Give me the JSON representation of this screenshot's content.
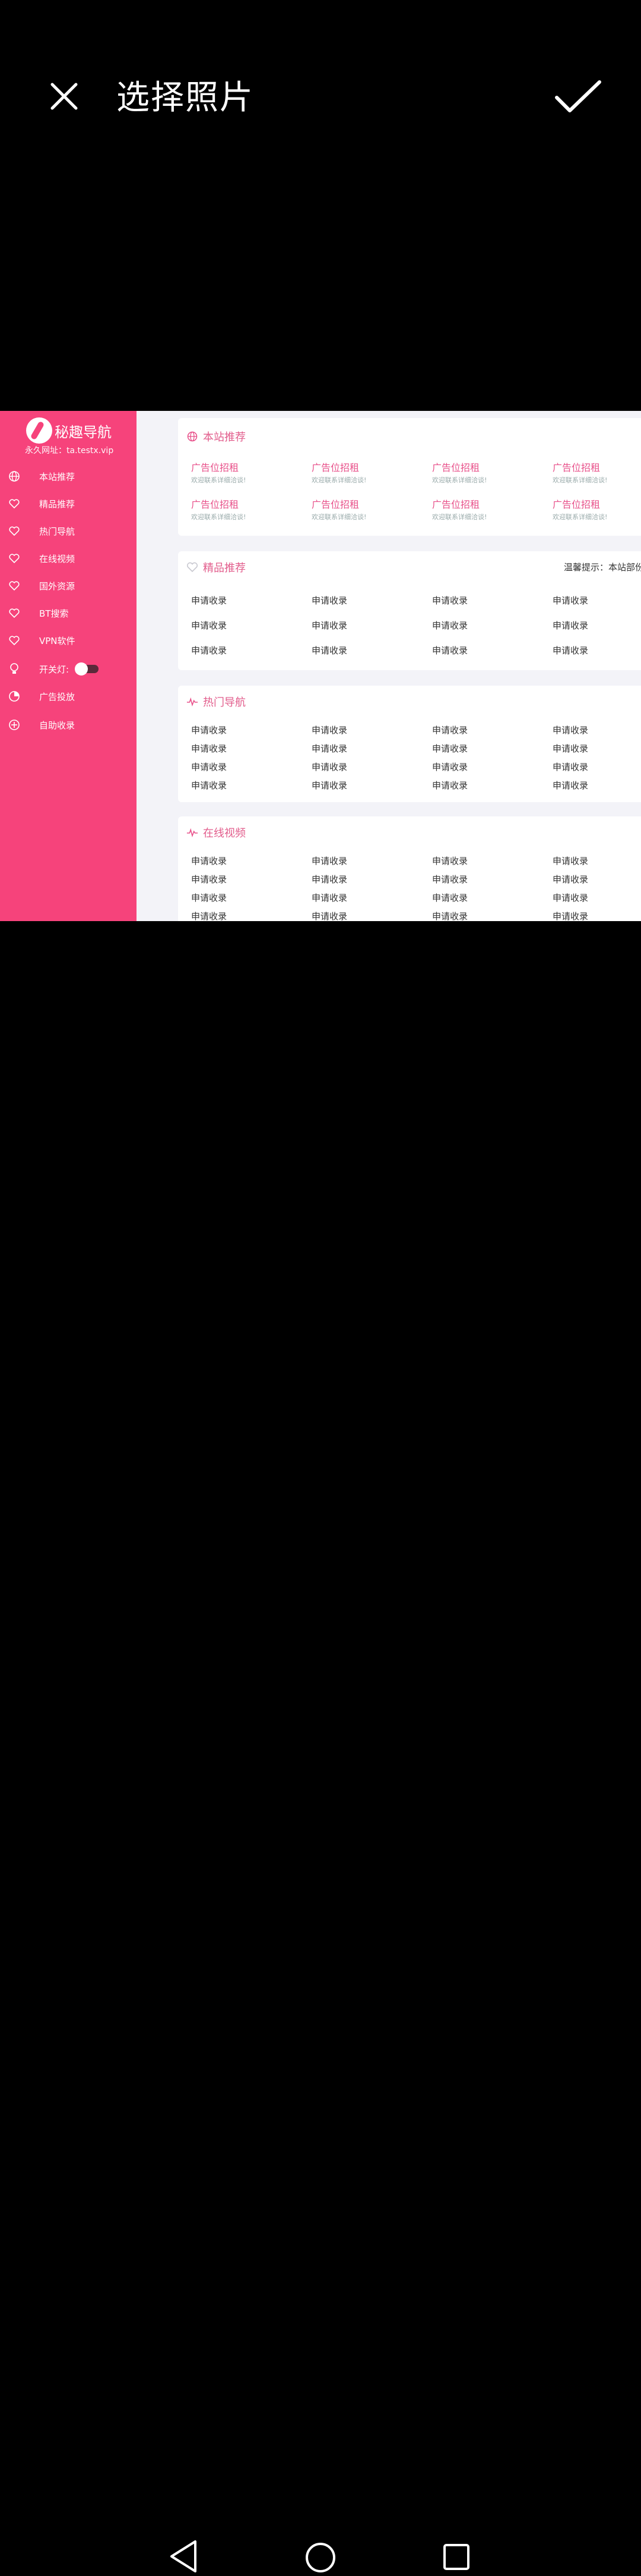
{
  "header": {
    "title": "选择照片",
    "close_icon": "close-icon",
    "confirm_icon": "check-icon"
  },
  "photo": {
    "sidebar": {
      "logo_text": "秘趣导航",
      "site_url": "永久网址：ta.testx.vip",
      "items": [
        {
          "label": "本站推荐",
          "icon": "globe-icon"
        },
        {
          "label": "精品推荐",
          "icon": "heart-icon"
        },
        {
          "label": "热门导航",
          "icon": "heart-icon"
        },
        {
          "label": "在线视频",
          "icon": "heart-icon"
        },
        {
          "label": "国外资源",
          "icon": "heart-icon"
        },
        {
          "label": "BT搜索",
          "icon": "heart-icon"
        },
        {
          "label": "VPN软件",
          "icon": "heart-icon"
        },
        {
          "label": "开关灯:",
          "icon": "bulb-icon"
        },
        {
          "label": "广告投放",
          "icon": "pie-icon"
        },
        {
          "label": "自助收录",
          "icon": "plus-circle-icon"
        }
      ]
    },
    "sections": {
      "recommend": {
        "title": "本站推荐",
        "ads": [
          {
            "title": "广告位招租",
            "sub": "欢迎联系详细洽谈!"
          },
          {
            "title": "广告位招租",
            "sub": "欢迎联系详细洽谈!"
          },
          {
            "title": "广告位招租",
            "sub": "欢迎联系详细洽谈!"
          },
          {
            "title": "广告位招租",
            "sub": "欢迎联系详细洽谈!"
          },
          {
            "title": "广告位招租",
            "sub": "欢迎联系详细洽谈!"
          },
          {
            "title": "广告位招租",
            "sub": "欢迎联系详细洽谈!"
          },
          {
            "title": "广告位招租",
            "sub": "欢迎联系详细洽谈!"
          },
          {
            "title": "广告位招租",
            "sub": "欢迎联系详细洽谈!"
          }
        ]
      },
      "featured": {
        "title": "精品推荐",
        "notice": "温馨提示：本站部份收",
        "links": [
          "申请收录",
          "申请收录",
          "申请收录",
          "申请收录",
          "申请收录",
          "申请收录",
          "申请收录",
          "申请收录",
          "申请收录",
          "申请收录",
          "申请收录",
          "申请收录"
        ]
      },
      "hot": {
        "title": "热门导航",
        "links": [
          "申请收录",
          "申请收录",
          "申请收录",
          "申请收录",
          "申请收录",
          "申请收录",
          "申请收录",
          "申请收录",
          "申请收录",
          "申请收录",
          "申请收录",
          "申请收录",
          "申请收录",
          "申请收录",
          "申请收录",
          "申请收录"
        ]
      },
      "video": {
        "title": "在线视频",
        "links": [
          "申请收录",
          "申请收录",
          "申请收录",
          "申请收录",
          "申请收录",
          "申请收录",
          "申请收录",
          "申请收录",
          "申请收录",
          "申请收录",
          "申请收录",
          "申请收录",
          "申请收录",
          "申请收录",
          "申请收录",
          "申请收录"
        ]
      }
    }
  },
  "navbar": {
    "back_icon": "back-triangle-icon",
    "home_icon": "home-circle-icon",
    "recent_icon": "recent-square-icon"
  },
  "colors": {
    "accent": "#f6437b",
    "text_pink": "#e8508a"
  }
}
